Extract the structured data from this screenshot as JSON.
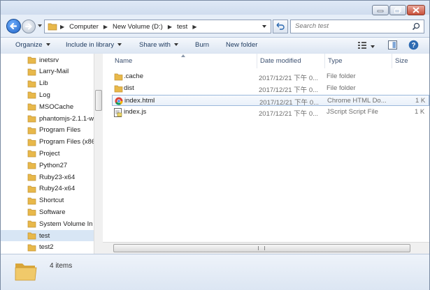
{
  "breadcrumb": [
    "Computer",
    "New Volume (D:)",
    "test"
  ],
  "search": {
    "placeholder": "Search test"
  },
  "toolbar": {
    "organize": "Organize",
    "include_in_library": "Include in library",
    "share_with": "Share with",
    "burn": "Burn",
    "new_folder": "New folder"
  },
  "nav_items": [
    "inetsrv",
    "Larry-Mail",
    "Lib",
    "Log",
    "MSOCache",
    "phantomjs-2.1.1-w",
    "Program Files",
    "Program Files (x86",
    "Project",
    "Python27",
    "Ruby23-x64",
    "Ruby24-x64",
    "Shortcut",
    "Software",
    "System Volume In",
    "test",
    "test2"
  ],
  "nav_selected": "test",
  "columns": {
    "name": "Name",
    "date": "Date modified",
    "type": "Type",
    "size": "Size"
  },
  "files": [
    {
      "name": ".cache",
      "date": "2017/12/21 下午 0...",
      "type": "File folder",
      "size": "",
      "icon": "folder-icon"
    },
    {
      "name": "dist",
      "date": "2017/12/21 下午 0...",
      "type": "File folder",
      "size": "",
      "icon": "folder-icon"
    },
    {
      "name": "index.html",
      "date": "2017/12/21 下午 0...",
      "type": "Chrome HTML Do...",
      "size": "1 K",
      "icon": "chrome-icon"
    },
    {
      "name": "index.js",
      "date": "2017/12/21 下午 0...",
      "type": "JScript Script File",
      "size": "1 K",
      "icon": "jscript-icon"
    }
  ],
  "status": {
    "count": "4 items"
  },
  "colors": {
    "folder": "#e8b84a",
    "selection": "#d8e6f5",
    "hover_border": "#9bb8db"
  }
}
